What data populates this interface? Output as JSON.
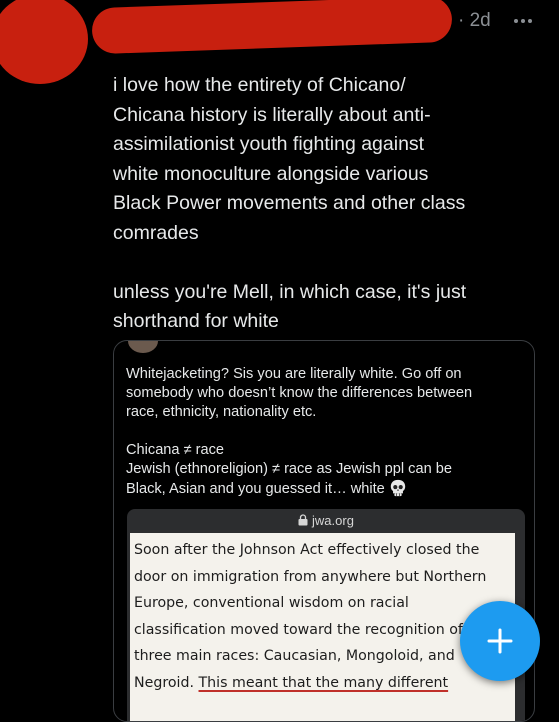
{
  "tweet": {
    "timestamp": "· 2d",
    "text": "i love how the entirety of Chicano/\nChicana history is literally about anti-\nassimilationist youth fighting against\nwhite monoculture alongside various\nBlack Power movements and other class\ncomrades\n\nunless you're Mell, in which case, it's just\nshorthand for white"
  },
  "quote": {
    "text": "Whitejacketing? Sis you are literally white. Go off on\nsomebody who doesn’t know the differences between\nrace, ethnicity, nationality etc.\n\nChicana ≠ race\nJewish (ethnoreligion) ≠ race as Jewish ppl can be\nBlack, Asian and you guessed it… white",
    "article": {
      "url": "jwa.org",
      "text_plain": "Soon after the Johnson Act effectively closed the\ndoor on immigration from anywhere but Northern\nEurope, conventional wisdom on racial\nclassification moved toward the recognition of\nthree main races: Caucasian, Mongoloid, and\nNegroid. ",
      "text_underlined": "This meant that the many different"
    }
  },
  "colors": {
    "background": "#000000",
    "redaction": "#c8200f",
    "fab": "#1d9bf0"
  },
  "icons": {
    "more": "more-horizontal-icon",
    "skull": "skull-emoji-icon",
    "lock": "lock-icon",
    "compose": "plus-icon"
  }
}
